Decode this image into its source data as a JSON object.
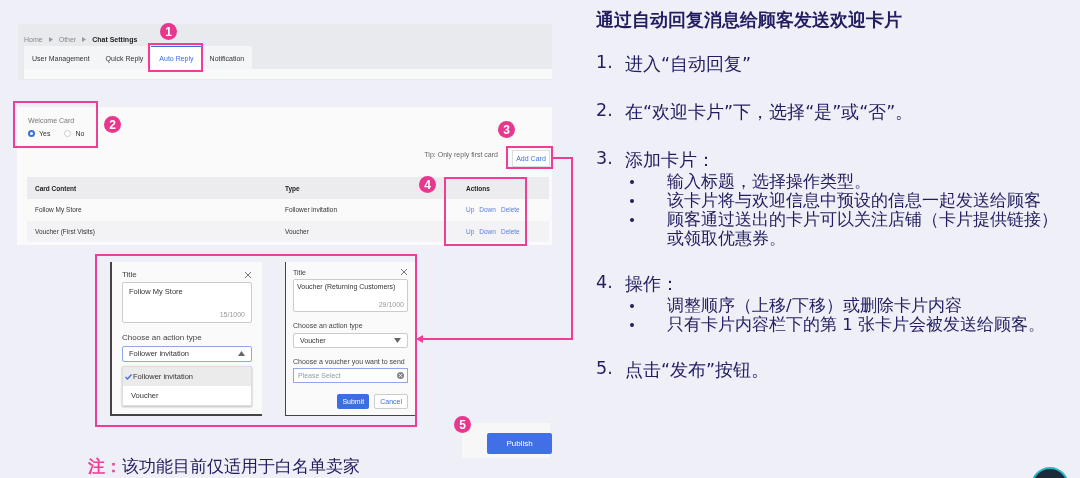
{
  "settings_page": {
    "breadcrumb": [
      "Home",
      "Other",
      "Chat Settings"
    ],
    "tabs": [
      {
        "label": "User Management",
        "selected": false
      },
      {
        "label": "Quick Reply",
        "selected": false
      },
      {
        "label": "Auto Reply",
        "selected": true
      },
      {
        "label": "Notification",
        "selected": false
      }
    ]
  },
  "welcome_card": {
    "label": "Welcome Card",
    "options": [
      {
        "label": "Yes",
        "selected": true
      },
      {
        "label": "No",
        "selected": false
      }
    ],
    "tip": "Tip: Only reply first card",
    "add_button": "Add Card"
  },
  "table": {
    "columns": [
      "Card Content",
      "Type",
      "Actions"
    ],
    "rows": [
      {
        "content": "Follow My Store",
        "type": "Follower invitation",
        "actions": [
          "Up",
          "Down",
          "Delete"
        ]
      },
      {
        "content": "Voucher (First Visits)",
        "type": "Voucher",
        "actions": [
          "Up",
          "Down",
          "Delete"
        ]
      }
    ]
  },
  "dialogs": [
    {
      "title_label": "Title",
      "title_value": "Follow My Store",
      "counter": "15/1000",
      "action_label": "Choose an action type",
      "action_value": "Follower invitation",
      "dropdown": [
        {
          "label": "Follower invitation",
          "selected": true
        },
        {
          "label": "Voucher",
          "selected": false
        }
      ]
    },
    {
      "title_label": "Title",
      "title_value": "Voucher (Returning Customers)",
      "counter": "29/1000",
      "action_label": "Choose an action type",
      "action_value": "Voucher",
      "voucher_label": "Choose a voucher you want to send",
      "voucher_placeholder": "Please Select",
      "buttons": [
        "Submit",
        "Cancel"
      ]
    }
  ],
  "publish_button": "Publish",
  "callouts": [
    "1",
    "2",
    "3",
    "4",
    "5"
  ],
  "note": {
    "label": "注：",
    "text": "该功能目前仅适用于白名单卖家"
  },
  "instructions": {
    "title": "通过自动回复消息给顾客发送欢迎卡片",
    "steps": [
      {
        "number": "1.",
        "text": "进入“自动回复”"
      },
      {
        "number": "2.",
        "text": "在“欢迎卡片”下，选择“是”或“否”。"
      },
      {
        "number": "3.",
        "text": "添加卡片：",
        "bullets": [
          "输入标题，选择操作类型。",
          "该卡片将与欢迎信息中预设的信息一起发送给顾客",
          "顾客通过送出的卡片可以关注店铺（卡片提供链接）或领取优惠券。"
        ]
      },
      {
        "number": "4.",
        "text": "操作：",
        "bullets": [
          "调整顺序（上移/下移）或删除卡片内容",
          "只有卡片内容栏下的第 1 张卡片会被发送给顾客。"
        ]
      },
      {
        "number": "5.",
        "text": "点击“发布”按钮。"
      }
    ]
  }
}
